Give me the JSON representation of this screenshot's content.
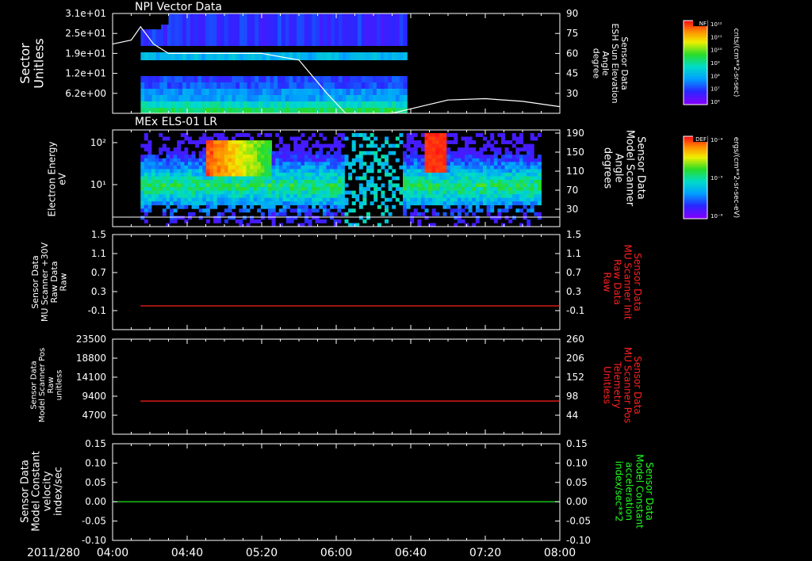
{
  "colors": {
    "background": "#000000",
    "foreground": "#ffffff",
    "red": "#ff2020",
    "green": "#20ff20"
  },
  "x_axis": {
    "date_label": "2011/280",
    "ticks": [
      "04:00",
      "04:40",
      "05:20",
      "06:00",
      "06:40",
      "07:20",
      "08:00"
    ],
    "range": [
      "04:00",
      "08:00"
    ]
  },
  "chart_data": [
    {
      "type": "heatmap",
      "title": "NPI Vector Data",
      "ylabel": "Sector\nUnitless",
      "y_ticks": [
        "3.1e+01",
        "2.5e+01",
        "1.9e+01",
        "1.2e+01",
        "6.2e+00"
      ],
      "ylim": [
        0,
        31
      ],
      "right_ylabel": "Sensor Data\nESH Sun Elevation\nAngle\ndegree",
      "right_ticks": [
        "90",
        "75",
        "60",
        "45",
        "30"
      ],
      "right_ylim": [
        15,
        90
      ],
      "right_series": {
        "name": "ESH Sun Elevation Angle",
        "color": "#ffffff",
        "x": [
          "04:00",
          "04:10",
          "04:15",
          "04:22",
          "04:30",
          "05:20",
          "05:40",
          "05:55",
          "06:05",
          "06:30",
          "06:45",
          "07:00",
          "07:20",
          "07:40",
          "08:00"
        ],
        "y": [
          67,
          70,
          80,
          67,
          60,
          60,
          55,
          30,
          15,
          15,
          20,
          25,
          26,
          24,
          20
        ]
      },
      "colorbar": {
        "label": "NF",
        "units": "cnts/(cm**2-sr-sec)",
        "ticks": [
          "10¹²",
          "10¹¹",
          "10¹⁰",
          "10⁹",
          "10⁸",
          "10⁷",
          "10⁶"
        ]
      }
    },
    {
      "type": "heatmap",
      "title": "MEx ELS-01 LR",
      "ylabel": "Electron Energy\neV",
      "y_ticks": [
        "10²",
        "10¹"
      ],
      "right_ylabel": "Sensor Data\nModel Scanner\nAngle\ndegrees",
      "right_ticks": [
        "190",
        "150",
        "110",
        "70",
        "30"
      ],
      "right_ylim": [
        0,
        190
      ],
      "right_series": {
        "name": "Model Scanner Angle",
        "color": "#ffffff",
        "x": [
          "04:00",
          "08:00"
        ],
        "y": [
          10,
          10
        ]
      },
      "colorbar": {
        "label": "DEF",
        "units": "ergs/(cm**2-sr-sec-eV)",
        "ticks": [
          "10⁻⁴",
          "10⁻⁵",
          "10⁻⁶"
        ]
      }
    },
    {
      "type": "line",
      "ylabel": "Sensor Data\nMU Scanner +30V\nRaw Data\nRaw",
      "y_ticks": [
        "1.5",
        "1.1",
        "0.7",
        "0.3",
        "-0.1"
      ],
      "ylim": [
        -0.5,
        1.5
      ],
      "right_ylabel": "Sensor Data\nMU Scanner Init\nRaw Data\nRaw",
      "right_ticks": [
        "1.5",
        "1.1",
        "0.7",
        "0.3",
        "-0.1"
      ],
      "right_ylim": [
        -0.5,
        1.5
      ],
      "series": [
        {
          "name": "MU Scanner Init Raw Data",
          "color": "#ff2020",
          "x": [
            "04:15",
            "08:00"
          ],
          "y": [
            0.0,
            0.0
          ]
        }
      ]
    },
    {
      "type": "line",
      "ylabel": "Sensor Data\nModel Scanner Pos\nRaw\nunitless",
      "y_ticks": [
        "23500",
        "18800",
        "14100",
        "9400",
        "4700"
      ],
      "ylim": [
        0,
        23500
      ],
      "right_ylabel": "Sensor Data\nMU Scanner Pos\nTelemetry\nUnitless",
      "right_ticks": [
        "260",
        "206",
        "152",
        "98",
        "44"
      ],
      "right_ylim": [
        -10,
        260
      ],
      "series": [
        {
          "name": "MU Scanner Pos Telemetry",
          "color": "#ff2020",
          "x": [
            "04:15",
            "08:00"
          ],
          "y": [
            8200,
            8200
          ]
        }
      ]
    },
    {
      "type": "line",
      "ylabel": "Sensor Data\nModel Constant\nvelocity\nindex/sec",
      "y_ticks": [
        "0.15",
        "0.10",
        "0.05",
        "0.00",
        "-0.05",
        "-0.10"
      ],
      "ylim": [
        -0.1,
        0.15
      ],
      "right_ylabel": "Sensor Data\nModel Constant\nacceleration\nindex/sec**2",
      "right_ticks": [
        "0.15",
        "0.10",
        "0.05",
        "0.00",
        "-0.05",
        "-0.10"
      ],
      "right_ylim": [
        -0.1,
        0.15
      ],
      "series": [
        {
          "name": "Model Constant acceleration",
          "color": "#20ff20",
          "x": [
            "04:00",
            "08:00"
          ],
          "y": [
            0.0,
            0.0
          ]
        }
      ]
    }
  ]
}
